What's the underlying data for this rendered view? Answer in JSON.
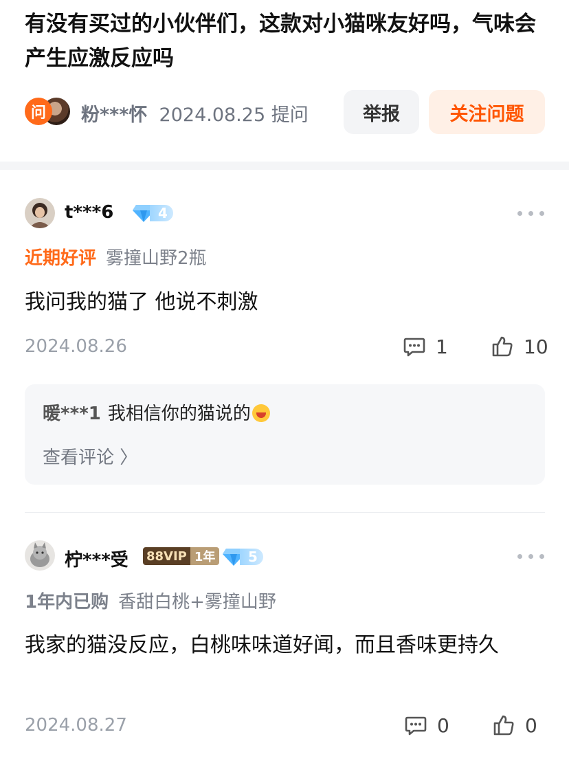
{
  "question": {
    "title": "有没有买过的小伙伴们，这款对小猫咪友好吗，气味会产生应激反应吗",
    "ask_icon_label": "问",
    "asker_name": "粉***怀",
    "date": "2024.08.25",
    "action": "提问",
    "report_label": "举报",
    "follow_label": "关注问题"
  },
  "reviews": [
    {
      "user": "t***6",
      "diamond_level": "4",
      "tag": "近期好评",
      "tag_color": "#ff6a1a",
      "spec": "雾撞山野2瓶",
      "content": "我问我的猫了 他说不刺激",
      "date": "2024.08.26",
      "comment_count": "1",
      "like_count": "10",
      "reply": {
        "user": "暖***1",
        "text": "我相信你的猫说的",
        "emoji": "laughing-emoji",
        "view_label": "查看评论 〉"
      }
    },
    {
      "user": "柠***受",
      "vip_label": "88VIP",
      "vip_years": "1年",
      "diamond_level": "5",
      "tag": "1年内已购",
      "tag_color": "#7c818b",
      "spec": "香甜白桃+雾撞山野",
      "content": "我家的猫没反应，白桃味味道好闻，而且香味更持久",
      "date": "2024.08.27",
      "comment_count": "0",
      "like_count": "0"
    }
  ],
  "icons": {
    "more": "more-dots-icon",
    "comment": "comment-bubble-icon",
    "like": "thumbs-up-icon",
    "diamond": "diamond-icon"
  },
  "colors": {
    "accent": "#ff5500",
    "follow_bg": "#fff0e6",
    "diamond": "#4fb3ff"
  }
}
